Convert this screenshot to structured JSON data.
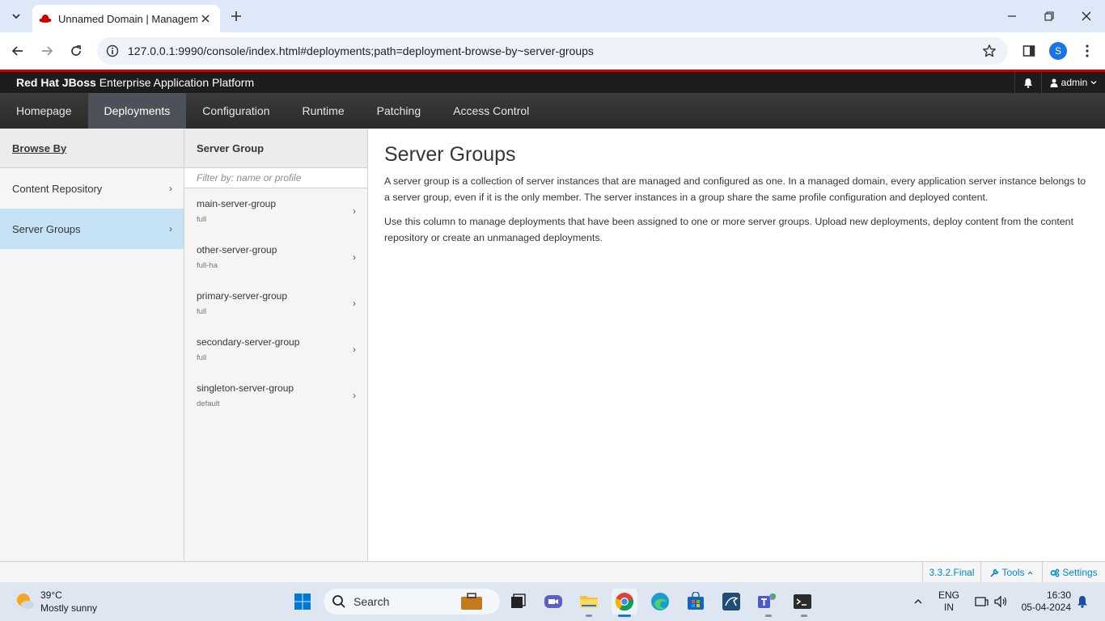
{
  "browser": {
    "tab_title": "Unnamed Domain | Manageme",
    "url": "127.0.0.1:9990/console/index.html#deployments;path=deployment-browse-by~server-groups",
    "profile_initial": "S"
  },
  "app": {
    "brand_bold": "Red Hat JBoss",
    "brand_rest": " Enterprise Application Platform",
    "user": "admin",
    "nav": [
      "Homepage",
      "Deployments",
      "Configuration",
      "Runtime",
      "Patching",
      "Access Control"
    ],
    "active_nav": "Deployments"
  },
  "browse_by": {
    "header": "Browse By",
    "items": [
      {
        "label": "Content Repository",
        "selected": false
      },
      {
        "label": "Server Groups",
        "selected": true
      }
    ]
  },
  "server_group_column": {
    "header": "Server Group",
    "filter_placeholder": "Filter by: name or profile",
    "items": [
      {
        "name": "main-server-group",
        "profile": "full"
      },
      {
        "name": "other-server-group",
        "profile": "full-ha"
      },
      {
        "name": "primary-server-group",
        "profile": "full"
      },
      {
        "name": "secondary-server-group",
        "profile": "full"
      },
      {
        "name": "singleton-server-group",
        "profile": "default"
      }
    ]
  },
  "content": {
    "title": "Server Groups",
    "p1": "A server group is a collection of server instances that are managed and configured as one. In a managed domain, every application server instance belongs to a server group, even if it is the only member. The server instances in a group share the same profile configuration and deployed content.",
    "p2": "Use this column to manage deployments that have been assigned to one or more server groups. Upload new deployments, deploy content from the content repository or create an unmanaged deployments."
  },
  "footer": {
    "version": "3.3.2.Final",
    "tools": "Tools",
    "settings": "Settings"
  },
  "taskbar": {
    "temp": "39°C",
    "weather": "Mostly sunny",
    "search": "Search",
    "lang1": "ENG",
    "lang2": "IN",
    "time": "16:30",
    "date": "05-04-2024"
  },
  "colors": {
    "selected_row": "#c5e2f5",
    "brand_red": "#cc0000",
    "link": "#0088ce"
  }
}
